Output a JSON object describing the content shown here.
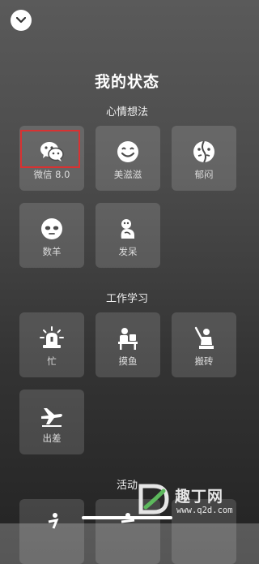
{
  "page": {
    "title": "我的状态",
    "watermark_text": "趣丁网",
    "watermark_url": "www.q2d.com"
  },
  "sections": [
    {
      "title": "心情想法",
      "items": [
        {
          "label": "微信 8.0",
          "icon": "wechat-icon",
          "selected": true
        },
        {
          "label": "美滋滋",
          "icon": "smile-icon"
        },
        {
          "label": "郁闷",
          "icon": "gloomy-face-icon"
        },
        {
          "label": "数羊",
          "icon": "sheep-icon"
        },
        {
          "label": "发呆",
          "icon": "daze-icon"
        }
      ]
    },
    {
      "title": "工作学习",
      "items": [
        {
          "label": "忙",
          "icon": "busy-siren-icon"
        },
        {
          "label": "摸鱼",
          "icon": "slacking-desk-icon"
        },
        {
          "label": "搬砖",
          "icon": "brick-work-icon"
        },
        {
          "label": "出差",
          "icon": "airplane-icon"
        }
      ]
    },
    {
      "title": "活动",
      "items": []
    }
  ],
  "colors": {
    "highlight": "#d83232"
  }
}
